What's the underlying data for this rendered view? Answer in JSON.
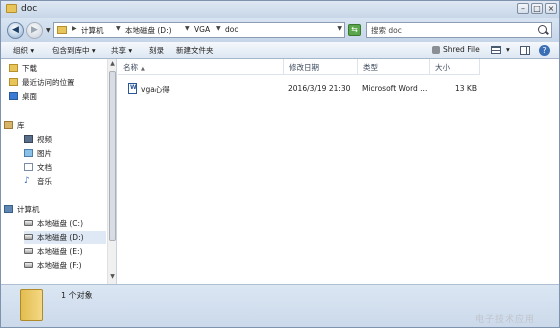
{
  "window": {
    "title": "doc"
  },
  "nav": {
    "back_glyph": "◀",
    "forward_glyph": "▶",
    "breadcrumbs": [
      "计算机",
      "本地磁盘 (D:)",
      "VGA",
      "doc"
    ],
    "search_placeholder": "搜索 doc"
  },
  "toolbar": {
    "organize": "组织 ▾",
    "include_library": "包含到库中 ▾",
    "share": "共享 ▾",
    "burn": "刻录",
    "new_folder": "新建文件夹",
    "shred": "Shred File",
    "view_arrow": "▾",
    "help": "?"
  },
  "sidebar": {
    "favorites": [
      {
        "label": "下载",
        "icon": "download-folder-icon"
      },
      {
        "label": "最近访问的位置",
        "icon": "recent-places-icon"
      },
      {
        "label": "桌面",
        "icon": "desktop-icon"
      }
    ],
    "libraries_label": "库",
    "libraries": [
      {
        "label": "视频",
        "icon": "video-library-icon"
      },
      {
        "label": "图片",
        "icon": "pictures-library-icon"
      },
      {
        "label": "文档",
        "icon": "documents-library-icon"
      },
      {
        "label": "音乐",
        "icon": "music-library-icon"
      }
    ],
    "computer_label": "计算机",
    "drives": [
      {
        "label": "本地磁盘 (C:)"
      },
      {
        "label": "本地磁盘 (D:)",
        "selected": true
      },
      {
        "label": "本地磁盘 (E:)"
      },
      {
        "label": "本地磁盘 (F:)"
      }
    ]
  },
  "columns": {
    "name": "名称",
    "modified": "修改日期",
    "type": "类型",
    "size": "大小"
  },
  "files": [
    {
      "name": "vga心得",
      "modified": "2016/3/19 21:30",
      "type": "Microsoft Word ...",
      "size": "13 KB",
      "icon": "word-document-icon"
    }
  ],
  "status": {
    "count_text": "1 个对象"
  },
  "watermark": "电子技术应用"
}
